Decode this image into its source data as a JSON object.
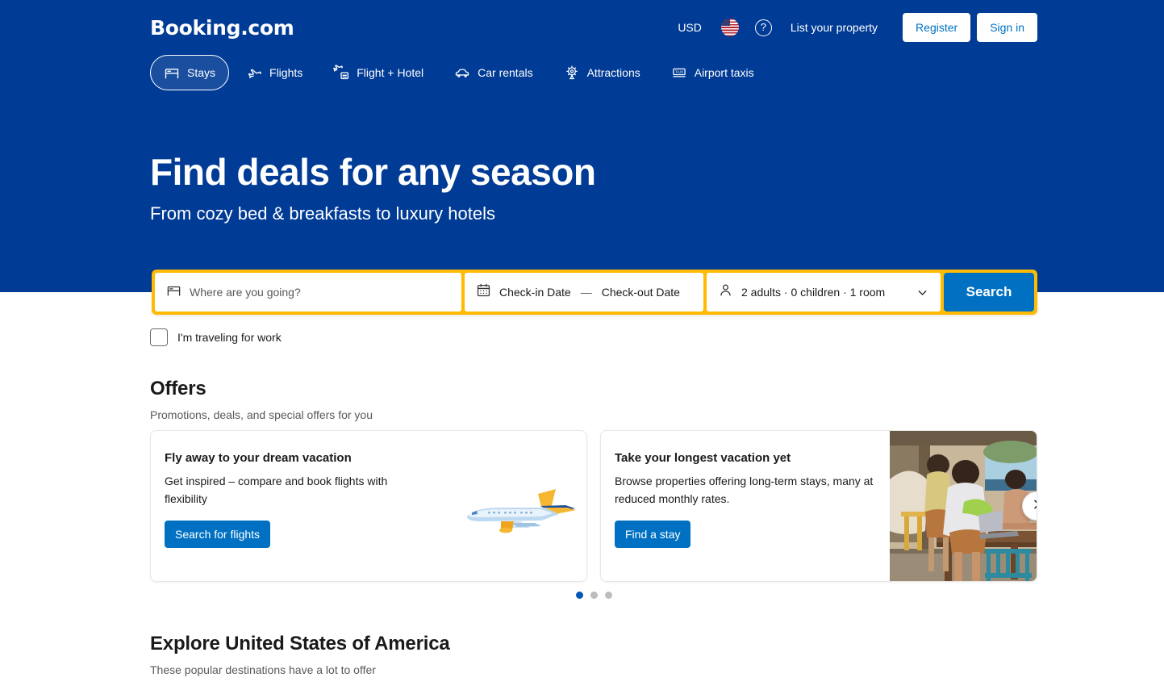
{
  "header": {
    "logo": "Booking.com",
    "currency": "USD",
    "language_flag": "us-flag-icon",
    "help": "help-circle-icon",
    "help_glyph": "?",
    "list_property": "List your property",
    "register": "Register",
    "sign_in": "Sign in"
  },
  "nav": {
    "items": [
      {
        "label": "Stays",
        "icon": "bed-icon",
        "active": true
      },
      {
        "label": "Flights",
        "icon": "airplane-icon",
        "active": false
      },
      {
        "label": "Flight + Hotel",
        "icon": "flight-hotel-icon",
        "active": false
      },
      {
        "label": "Car rentals",
        "icon": "car-icon",
        "active": false
      },
      {
        "label": "Attractions",
        "icon": "ferris-wheel-icon",
        "active": false
      },
      {
        "label": "Airport taxis",
        "icon": "taxi-sign-icon",
        "active": false
      }
    ]
  },
  "hero": {
    "title": "Find deals for any season",
    "subtitle": "From cozy bed & breakfasts to luxury hotels"
  },
  "search": {
    "destination_placeholder": "Where are you going?",
    "destination_icon": "bed-icon",
    "calendar_icon": "calendar-icon",
    "checkin_label": "Check-in Date",
    "date_separator": "—",
    "checkout_label": "Check-out Date",
    "person_icon": "person-icon",
    "occupancy": "2 adults · 0 children · 1 room",
    "chevron_icon": "chevron-down-icon",
    "search_button": "Search",
    "border_color": "#febb02",
    "button_color": "#0071c2"
  },
  "work_travel": {
    "label": "I'm traveling for work",
    "checked": false
  },
  "offers": {
    "title": "Offers",
    "subtitle": "Promotions, deals, and special offers for you",
    "cards": [
      {
        "title": "Fly away to your dream vacation",
        "description": "Get inspired – compare and book flights with flexibility",
        "cta": "Search for flights",
        "art": "airplane-illustration"
      },
      {
        "title": "Take your longest vacation yet",
        "description": "Browse properties offering long-term stays, many at reduced monthly rates.",
        "cta": "Find a stay",
        "art": "people-laptop-photo"
      }
    ],
    "next_icon": "chevron-right-icon",
    "dots": [
      {
        "active": true
      },
      {
        "active": false
      },
      {
        "active": false
      }
    ]
  },
  "explore": {
    "title": "Explore United States of America",
    "subtitle": "These popular destinations have a lot to offer"
  },
  "colors": {
    "brand_blue": "#003b95",
    "accent_blue": "#0071c2",
    "accent_yellow": "#febb02"
  }
}
